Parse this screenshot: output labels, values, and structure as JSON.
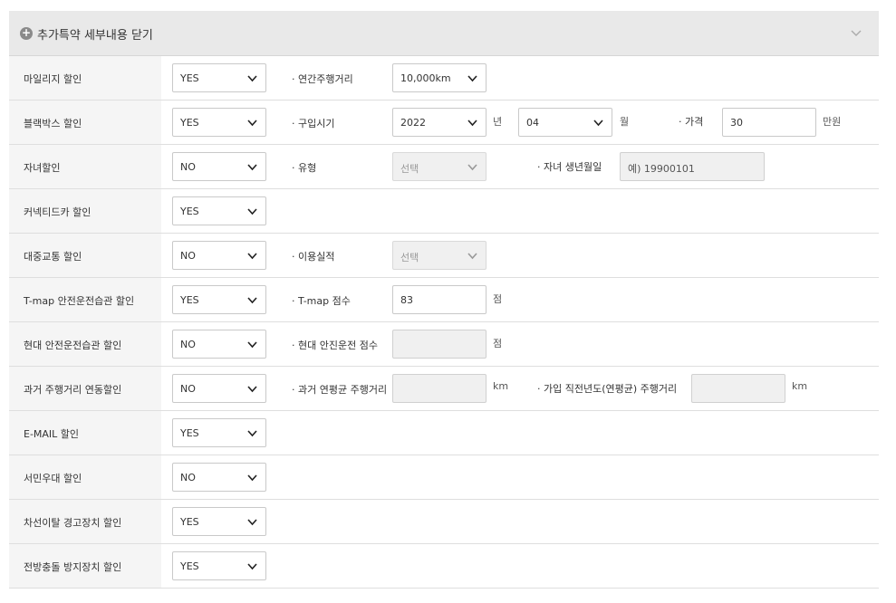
{
  "header": {
    "title": "추가특약 세부내용 닫기"
  },
  "rows": [
    {
      "label": "마일리지 할인",
      "select": "YES",
      "sub_label": "· 연간주행거리",
      "sub_select": "10,000km"
    },
    {
      "label": "블랙박스 할인",
      "select": "YES",
      "sub_label": "· 구입시기",
      "year": "2022",
      "year_unit": "년",
      "month": "04",
      "month_unit": "월",
      "price_label": "· 가격",
      "price_value": "30",
      "price_unit": "만원"
    },
    {
      "label": "자녀할인",
      "select": "NO",
      "sub_label": "· 유형",
      "sub_select": "선택",
      "birth_label": "· 자녀 생년월일",
      "birth_placeholder": "예) 19900101"
    },
    {
      "label": "커넥티드카 할인",
      "select": "YES"
    },
    {
      "label": "대중교통 할인",
      "select": "NO",
      "sub_label": "· 이용실적",
      "sub_select": "선택"
    },
    {
      "label": "T-map 안전운전습관 할인",
      "select": "YES",
      "sub_label": "· T-map 점수",
      "score": "83",
      "score_unit": "점"
    },
    {
      "label": "현대 안전운전습관 할인",
      "select": "NO",
      "sub_label": "· 현대 안진운전 점수",
      "score": "",
      "score_unit": "점"
    },
    {
      "label": "과거 주행거리 연동할인",
      "select": "NO",
      "sub_label": "· 과거 연평균 주행거리",
      "avg_km": "",
      "avg_unit": "km",
      "prev_label": "· 가입 직전년도(연평균) 주행거리",
      "prev_km": "",
      "prev_unit": "km"
    },
    {
      "label": "E-MAIL 할인",
      "select": "YES"
    },
    {
      "label": "서민우대 할인",
      "select": "NO"
    },
    {
      "label": "차선이탈 경고장치 할인",
      "select": "YES"
    },
    {
      "label": "전방충돌 방지장치 할인",
      "select": "YES"
    }
  ]
}
